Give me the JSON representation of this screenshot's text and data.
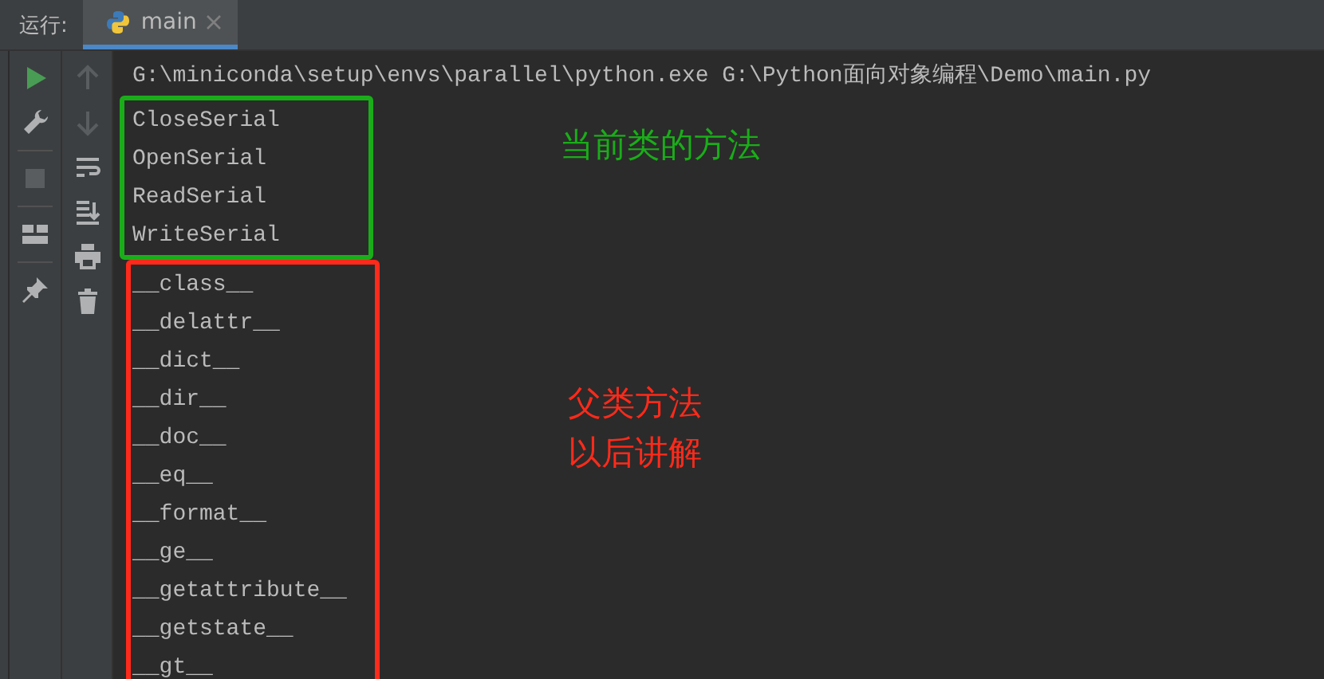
{
  "run_label": "运行:",
  "tabs": [
    {
      "label": "main",
      "selected": true
    }
  ],
  "console": {
    "command": "G:\\miniconda\\setup\\envs\\parallel\\python.exe G:\\Python面向对象编程\\Demo\\main.py",
    "groups": [
      {
        "color": "#1aad19",
        "note": [
          "当前类的方法"
        ],
        "lines": [
          "CloseSerial",
          "OpenSerial",
          "ReadSerial",
          "WriteSerial"
        ]
      },
      {
        "color": "#ff2a1a",
        "note": [
          "父类方法",
          "以后讲解"
        ],
        "lines": [
          "__class__",
          "__delattr__",
          "__dict__",
          "__dir__",
          "__doc__",
          "__eq__",
          "__format__",
          "__ge__",
          "__getattribute__",
          "__getstate__",
          "__gt__"
        ]
      }
    ]
  }
}
